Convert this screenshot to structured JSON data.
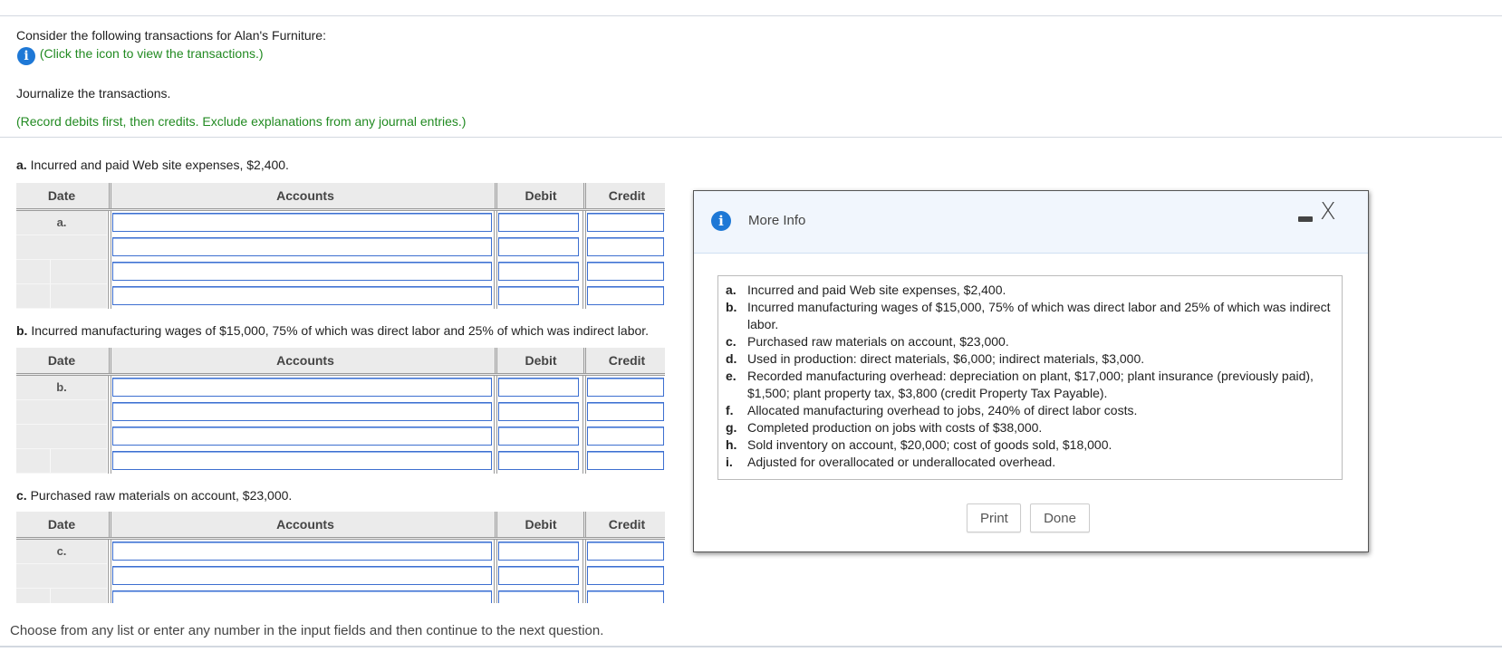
{
  "intro": {
    "consider_text": "Consider the following transactions for Alan's Furniture:",
    "info_icon": "info-icon",
    "click_hint": "(Click the icon to view the transactions.)",
    "instruction": "Journalize the transactions.",
    "record_hint": "(Record debits first, then credits. Exclude explanations from any journal entries.)"
  },
  "table_headers": {
    "date": "Date",
    "accounts": "Accounts",
    "debit": "Debit",
    "credit": "Credit"
  },
  "sections": [
    {
      "label": "a.",
      "description": "Incurred and paid Web site expenses, $2,400.",
      "date_label": "a.",
      "rows": 4
    },
    {
      "label": "b.",
      "description": "Incurred manufacturing wages of $15,000, 75% of which was direct labor and 25% of which was indirect labor.",
      "date_label": "b.",
      "rows": 4
    },
    {
      "label": "c.",
      "description": "Purchased raw materials on account, $23,000.",
      "date_label": "c.",
      "rows": 3
    }
  ],
  "footer": {
    "text": "Choose from any list or enter any number in the input fields and then continue to the next question."
  },
  "modal": {
    "title": "More Info",
    "minimize_icon": "minimize-icon",
    "close_icon": "close-icon",
    "close_glyph": "X",
    "items": [
      {
        "label": "a.",
        "text": "Incurred and paid Web site expenses, $2,400."
      },
      {
        "label": "b.",
        "text": "Incurred manufacturing wages of $15,000, 75% of which was direct labor and 25% of which was indirect labor."
      },
      {
        "label": "c.",
        "text": "Purchased raw materials on account, $23,000."
      },
      {
        "label": "d.",
        "text": "Used in production: direct materials, $6,000; indirect materials, $3,000."
      },
      {
        "label": "e.",
        "text": "Recorded manufacturing overhead: depreciation on plant, $17,000; plant insurance (previously paid), $1,500; plant property tax, $3,800 (credit Property Tax Payable)."
      },
      {
        "label": "f.",
        "text": "Allocated manufacturing overhead to jobs, 240% of direct labor costs."
      },
      {
        "label": "g.",
        "text": "Completed production on jobs with costs of $38,000."
      },
      {
        "label": "h.",
        "text": "Sold inventory on account, $20,000; cost of goods sold, $18,000."
      },
      {
        "label": "i.",
        "text": "Adjusted for overallocated or underallocated overhead."
      }
    ],
    "print_label": "Print",
    "done_label": "Done"
  },
  "colors": {
    "accent_green": "#218a21",
    "info_blue": "#1e78d6",
    "input_border": "#3d6fd0"
  }
}
